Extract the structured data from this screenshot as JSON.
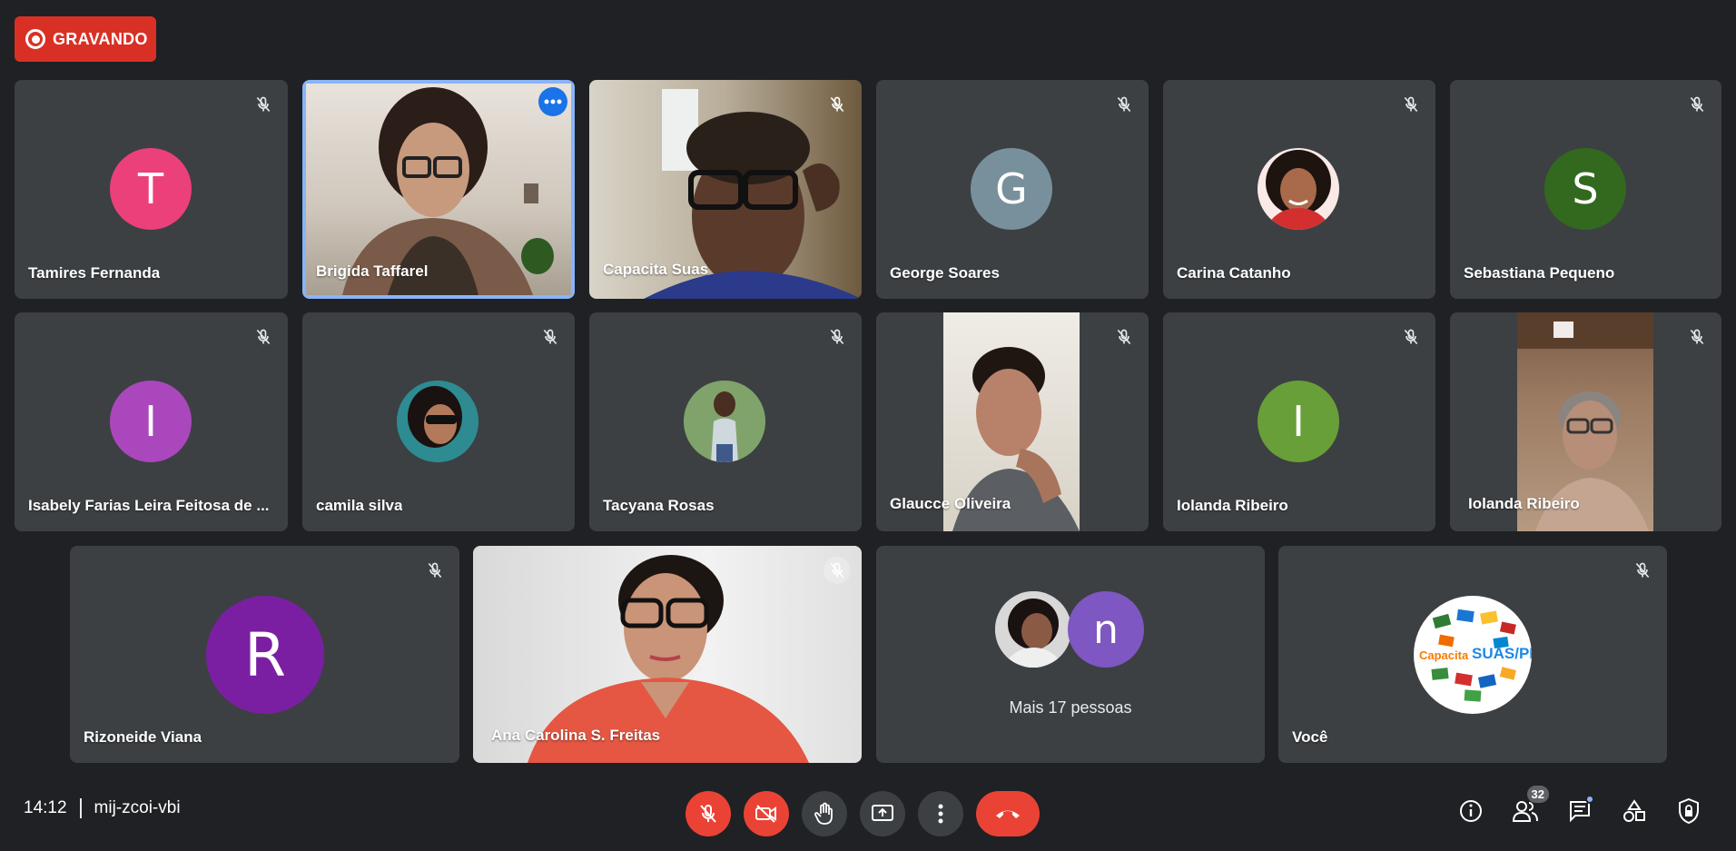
{
  "recording": {
    "label": "GRAVANDO"
  },
  "participants": [
    {
      "name": "Tamires Fernanda",
      "initial": "T",
      "color": "#ec407a"
    },
    {
      "name": "Brigida Taffarel"
    },
    {
      "name": "Capacita Suas"
    },
    {
      "name": "George Soares",
      "initial": "G",
      "color": "#78909c"
    },
    {
      "name": "Carina Catanho"
    },
    {
      "name": "Sebastiana Pequeno",
      "initial": "S",
      "color": "#33691e"
    },
    {
      "name": "Isabely Farias Leira Feitosa de ...",
      "initial": "I",
      "color": "#ab47bc"
    },
    {
      "name": "camila silva"
    },
    {
      "name": "Tacyana Rosas"
    },
    {
      "name": "Glaucce Oliveira"
    },
    {
      "name": "Iolanda Ribeiro",
      "initial": "I",
      "color": "#689f38"
    },
    {
      "name": "Iolanda Ribeiro"
    },
    {
      "name": "Rizoneide Viana",
      "initial": "R",
      "color": "#7b1fa2"
    },
    {
      "name": "Ana Carolina S. Freitas"
    }
  ],
  "others": {
    "label": "Mais 17 pessoas",
    "initial": "n",
    "color": "#7e57c2"
  },
  "self": {
    "name": "Você",
    "logo_text_left": "Capacita",
    "logo_text_right": "SUAS/PE"
  },
  "meeting": {
    "time": "14:12",
    "code": "mij-zcoi-vbi"
  },
  "people_count": "32",
  "colors": {
    "background": "#202124",
    "tile": "#3c4043",
    "danger": "#ea4335",
    "active": "#8ab4f8"
  }
}
